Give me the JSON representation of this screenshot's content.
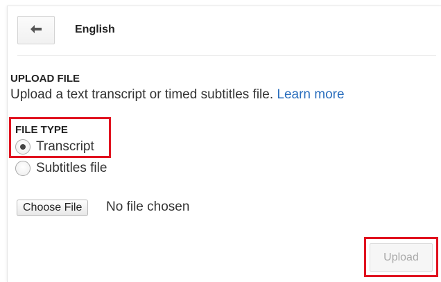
{
  "header": {
    "back_icon": "arrow-left-icon",
    "title": "English"
  },
  "upload": {
    "heading": "UPLOAD FILE",
    "description": "Upload a text transcript or timed subtitles file.",
    "learn_more": "Learn more"
  },
  "file_type": {
    "label": "FILE TYPE",
    "options": [
      {
        "label": "Transcript",
        "selected": true
      },
      {
        "label": "Subtitles file",
        "selected": false
      }
    ]
  },
  "file_input": {
    "button_label": "Choose File",
    "status": "No file chosen"
  },
  "actions": {
    "upload_label": "Upload"
  },
  "colors": {
    "highlight": "#e0121f",
    "link": "#2a6ebd"
  }
}
